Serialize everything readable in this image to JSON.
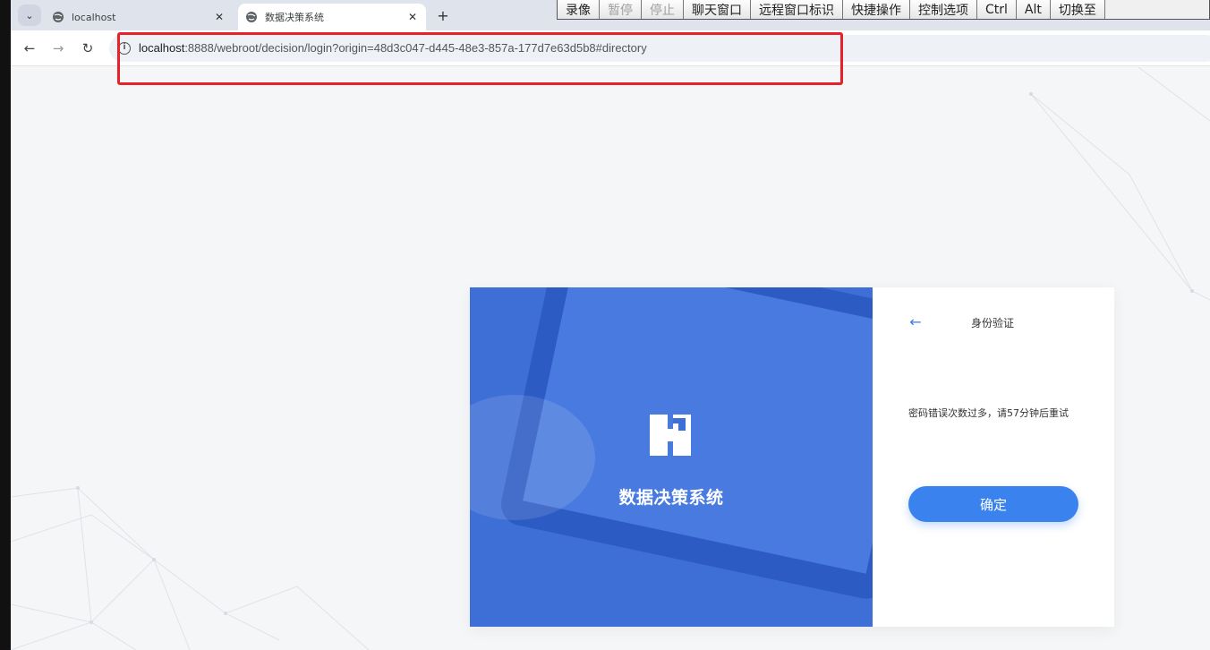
{
  "browser": {
    "tabs": [
      {
        "title": "localhost",
        "active": false
      },
      {
        "title": "数据决策系统",
        "active": true
      }
    ],
    "url_host": "localhost",
    "url_rest": ":8888/webroot/decision/login?origin=48d3c047-d445-48e3-857a-177d7e63d5b8#directory"
  },
  "remote_toolbar": {
    "buttons": [
      "录像",
      "暂停",
      "停止",
      "聊天窗口",
      "远程窗口标识",
      "快捷操作",
      "控制选项",
      "Ctrl",
      "Alt",
      "切换至"
    ]
  },
  "login": {
    "banner_title": "数据决策系统",
    "form_title": "身份验证",
    "error_message": "密码错误次数过多，请57分钟后重试",
    "confirm_label": "确定"
  },
  "colors": {
    "accent": "#3a82ee",
    "banner": "#3d6fd6",
    "highlight": "#e8222a"
  }
}
